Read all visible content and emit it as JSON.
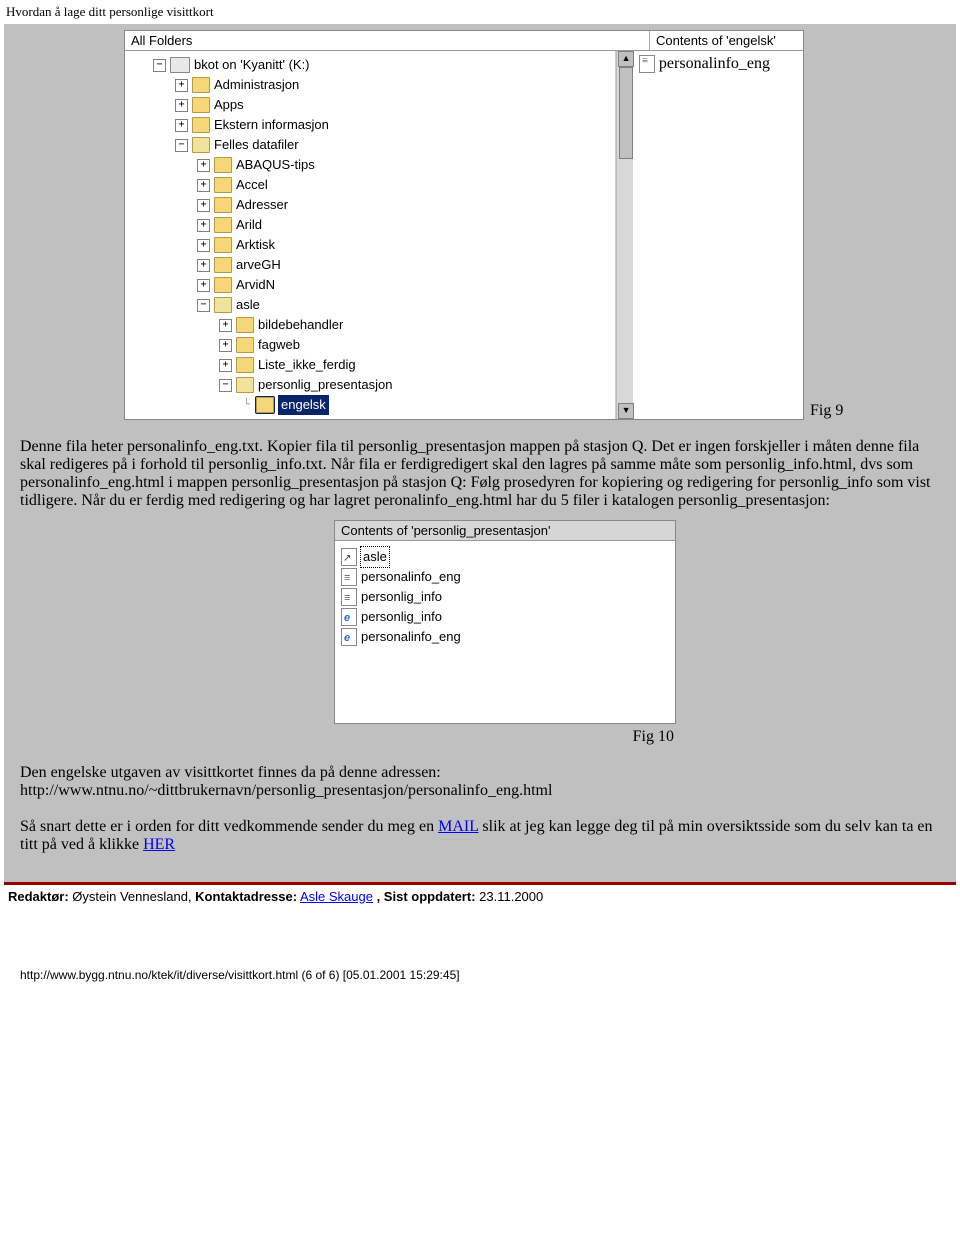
{
  "page_title": "Hvordan å lage ditt personlige visittkort",
  "fig9": {
    "left_title": "All Folders",
    "right_title": "Contents of 'engelsk'",
    "root": "bkot on 'Kyanitt' (K:)",
    "level1": [
      "Administrasjon",
      "Apps",
      "Ekstern informasjon",
      "Felles datafiler"
    ],
    "level2": [
      "ABAQUS-tips",
      "Accel",
      "Adresser",
      "Arild",
      "Arktisk",
      "arveGH",
      "ArvidN",
      "asle"
    ],
    "level3": [
      "bildebehandler",
      "fagweb",
      "Liste_ikke_ferdig",
      "personlig_presentasjon"
    ],
    "selected": "engelsk",
    "right_file": "personalinfo_eng",
    "caption": "Fig 9"
  },
  "para1": "Denne fila heter personalinfo_eng.txt. Kopier fila til personlig_presentasjon mappen på stasjon Q. Det er ingen forskjeller i måten denne fila skal redigeres på i forhold til personlig_info.txt. Når fila er ferdigredigert skal den lagres på samme måte som personlig_info.html, dvs som personalinfo_eng.html i mappen personlig_presentasjon på stasjon Q: Følg prosedyren for kopiering og redigering for personlig_info som vist tidligere. Når du er ferdig med redigering og har lagret peronalinfo_eng.html har du 5 filer i katalogen personlig_presentasjon:",
  "fig10": {
    "title": "Contents of 'personlig_presentasjon'",
    "files": [
      {
        "name": "asle",
        "type": "link"
      },
      {
        "name": "personalinfo_eng",
        "type": "doc"
      },
      {
        "name": "personlig_info",
        "type": "doc"
      },
      {
        "name": "personlig_info",
        "type": "ie"
      },
      {
        "name": "personalinfo_eng",
        "type": "ie"
      }
    ],
    "caption": "Fig 10"
  },
  "para2_a": "Den engelske utgaven av visittkortet finnes da på denne adressen:",
  "para2_b": "http://www.ntnu.no/~dittbrukernavn/personlig_presentasjon/personalinfo_eng.html",
  "para3_a": "Så snart dette er i orden for ditt vedkommende sender du meg en ",
  "para3_mail": "MAIL",
  "para3_b": " slik at jeg kan legge deg til på min oversiktsside som du selv kan ta en titt på ved å klikke ",
  "para3_her": "HER",
  "footer": {
    "redaktor_label": "Redaktør:",
    "redaktor_name": " Øystein Vennesland, ",
    "kontakt_label": "Kontaktadresse:",
    "kontakt_link": "Asle Skauge",
    "sist_label": ", Sist oppdatert:",
    "sist_date": " 23.11.2000"
  },
  "bottom_url": "http://www.bygg.ntnu.no/ktek/it/diverse/visittkort.html (6 of 6) [05.01.2001 15:29:45]"
}
